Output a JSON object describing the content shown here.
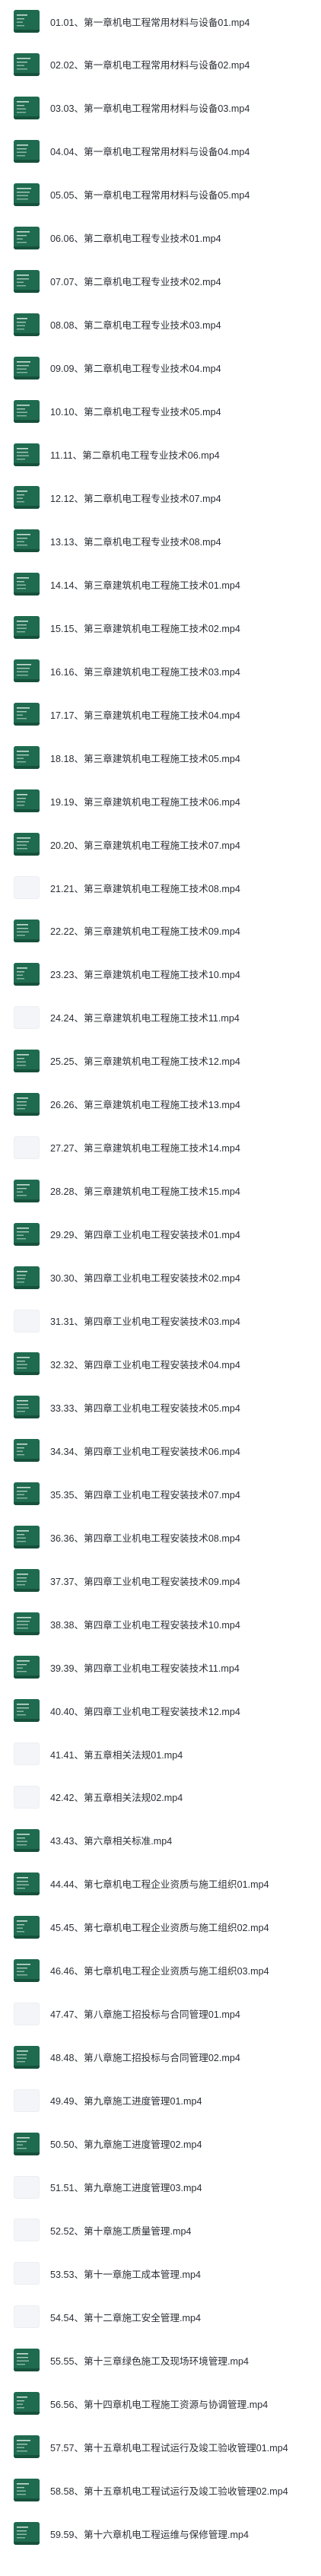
{
  "thumbnail_colors": {
    "board": "#1f6b4f",
    "blank": "#f3f5f8",
    "chalk": "#e8f2ec"
  },
  "files": [
    {
      "name": "01.01、第一章机电工程常用材料与设备01.mp4",
      "thumb": "board"
    },
    {
      "name": "02.02、第一章机电工程常用材料与设备02.mp4",
      "thumb": "board"
    },
    {
      "name": "03.03、第一章机电工程常用材料与设备03.mp4",
      "thumb": "board"
    },
    {
      "name": "04.04、第一章机电工程常用材料与设备04.mp4",
      "thumb": "board"
    },
    {
      "name": "05.05、第一章机电工程常用材料与设备05.mp4",
      "thumb": "board"
    },
    {
      "name": "06.06、第二章机电工程专业技术01.mp4",
      "thumb": "board"
    },
    {
      "name": "07.07、第二章机电工程专业技术02.mp4",
      "thumb": "board"
    },
    {
      "name": "08.08、第二章机电工程专业技术03.mp4",
      "thumb": "board"
    },
    {
      "name": "09.09、第二章机电工程专业技术04.mp4",
      "thumb": "board"
    },
    {
      "name": "10.10、第二章机电工程专业技术05.mp4",
      "thumb": "board"
    },
    {
      "name": "11.11、第二章机电工程专业技术06.mp4",
      "thumb": "board"
    },
    {
      "name": "12.12、第二章机电工程专业技术07.mp4",
      "thumb": "board"
    },
    {
      "name": "13.13、第二章机电工程专业技术08.mp4",
      "thumb": "board"
    },
    {
      "name": "14.14、第三章建筑机电工程施工技术01.mp4",
      "thumb": "board"
    },
    {
      "name": "15.15、第三章建筑机电工程施工技术02.mp4",
      "thumb": "board"
    },
    {
      "name": "16.16、第三章建筑机电工程施工技术03.mp4",
      "thumb": "board"
    },
    {
      "name": "17.17、第三章建筑机电工程施工技术04.mp4",
      "thumb": "board"
    },
    {
      "name": "18.18、第三章建筑机电工程施工技术05.mp4",
      "thumb": "board"
    },
    {
      "name": "19.19、第三章建筑机电工程施工技术06.mp4",
      "thumb": "board"
    },
    {
      "name": "20.20、第三章建筑机电工程施工技术07.mp4",
      "thumb": "board"
    },
    {
      "name": "21.21、第三章建筑机电工程施工技术08.mp4",
      "thumb": "blank"
    },
    {
      "name": "22.22、第三章建筑机电工程施工技术09.mp4",
      "thumb": "board"
    },
    {
      "name": "23.23、第三章建筑机电工程施工技术10.mp4",
      "thumb": "board"
    },
    {
      "name": "24.24、第三章建筑机电工程施工技术11.mp4",
      "thumb": "blank"
    },
    {
      "name": "25.25、第三章建筑机电工程施工技术12.mp4",
      "thumb": "board"
    },
    {
      "name": "26.26、第三章建筑机电工程施工技术13.mp4",
      "thumb": "board"
    },
    {
      "name": "27.27、第三章建筑机电工程施工技术14.mp4",
      "thumb": "blank"
    },
    {
      "name": "28.28、第三章建筑机电工程施工技术15.mp4",
      "thumb": "board"
    },
    {
      "name": "29.29、第四章工业机电工程安装技术01.mp4",
      "thumb": "board"
    },
    {
      "name": "30.30、第四章工业机电工程安装技术02.mp4",
      "thumb": "board"
    },
    {
      "name": "31.31、第四章工业机电工程安装技术03.mp4",
      "thumb": "blank"
    },
    {
      "name": "32.32、第四章工业机电工程安装技术04.mp4",
      "thumb": "board"
    },
    {
      "name": "33.33、第四章工业机电工程安装技术05.mp4",
      "thumb": "board"
    },
    {
      "name": "34.34、第四章工业机电工程安装技术06.mp4",
      "thumb": "board"
    },
    {
      "name": "35.35、第四章工业机电工程安装技术07.mp4",
      "thumb": "board"
    },
    {
      "name": "36.36、第四章工业机电工程安装技术08.mp4",
      "thumb": "board"
    },
    {
      "name": "37.37、第四章工业机电工程安装技术09.mp4",
      "thumb": "board"
    },
    {
      "name": "38.38、第四章工业机电工程安装技术10.mp4",
      "thumb": "board"
    },
    {
      "name": "39.39、第四章工业机电工程安装技术11.mp4",
      "thumb": "board"
    },
    {
      "name": "40.40、第四章工业机电工程安装技术12.mp4",
      "thumb": "board"
    },
    {
      "name": "41.41、第五章相关法规01.mp4",
      "thumb": "blank"
    },
    {
      "name": "42.42、第五章相关法规02.mp4",
      "thumb": "blank"
    },
    {
      "name": "43.43、第六章相关标准.mp4",
      "thumb": "board"
    },
    {
      "name": "44.44、第七章机电工程企业资质与施工组织01.mp4",
      "thumb": "board"
    },
    {
      "name": "45.45、第七章机电工程企业资质与施工组织02.mp4",
      "thumb": "board"
    },
    {
      "name": "46.46、第七章机电工程企业资质与施工组织03.mp4",
      "thumb": "board"
    },
    {
      "name": "47.47、第八章施工招投标与合同管理01.mp4",
      "thumb": "blank"
    },
    {
      "name": "48.48、第八章施工招投标与合同管理02.mp4",
      "thumb": "board"
    },
    {
      "name": "49.49、第九章施工进度管理01.mp4",
      "thumb": "blank"
    },
    {
      "name": "50.50、第九章施工进度管理02.mp4",
      "thumb": "board"
    },
    {
      "name": "51.51、第九章施工进度管理03.mp4",
      "thumb": "blank"
    },
    {
      "name": "52.52、第十章施工质量管理.mp4",
      "thumb": "blank"
    },
    {
      "name": "53.53、第十一章施工成本管理.mp4",
      "thumb": "blank"
    },
    {
      "name": "54.54、第十二章施工安全管理.mp4",
      "thumb": "blank"
    },
    {
      "name": "55.55、第十三章绿色施工及现场环境管理.mp4",
      "thumb": "board"
    },
    {
      "name": "56.56、第十四章机电工程施工资源与协调管理.mp4",
      "thumb": "board"
    },
    {
      "name": "57.57、第十五章机电工程试运行及竣工验收管理01.mp4",
      "thumb": "board"
    },
    {
      "name": "58.58、第十五章机电工程试运行及竣工验收管理02.mp4",
      "thumb": "board"
    },
    {
      "name": "59.59、第十六章机电工程运维与保修管理.mp4",
      "thumb": "board"
    }
  ]
}
